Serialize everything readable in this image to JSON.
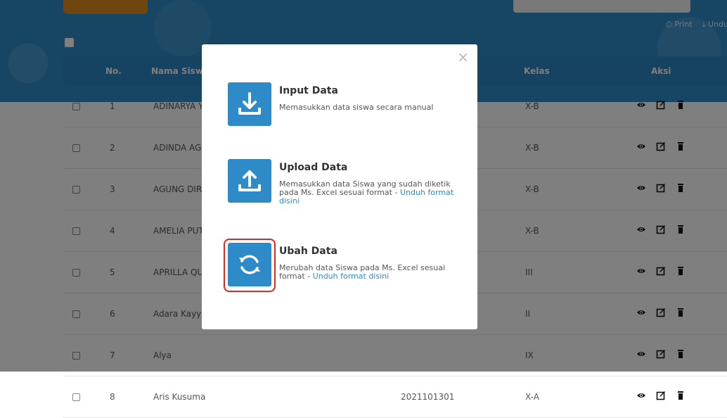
{
  "top": {
    "print_label": "⎙ Print",
    "unduh_label": "⤓ Undu"
  },
  "table": {
    "headers": [
      "No.",
      "Nama Siswa",
      "Kelas",
      "Aksi"
    ],
    "rows": [
      {
        "no": "1",
        "nama": "ADINARYA Y",
        "nis": "",
        "kelas": "X-B"
      },
      {
        "no": "2",
        "nama": "ADINDA AGU",
        "nis": "",
        "kelas": "X-B"
      },
      {
        "no": "3",
        "nama": "AGUNG DIRO",
        "nis": "",
        "kelas": "X-B"
      },
      {
        "no": "4",
        "nama": "AMELIA PUT",
        "nis": "",
        "kelas": "X-B"
      },
      {
        "no": "5",
        "nama": "APRILLA QU",
        "nis": "",
        "kelas": "III"
      },
      {
        "no": "6",
        "nama": "Adara Kayyis",
        "nis": "",
        "kelas": "II"
      },
      {
        "no": "7",
        "nama": "Alya",
        "nis": "",
        "kelas": "IX"
      },
      {
        "no": "8",
        "nama": "Aris Kusuma",
        "nis": "2021101301",
        "kelas": "X-A"
      }
    ]
  },
  "modal": {
    "close_glyph": "×",
    "options": [
      {
        "title": "Input Data",
        "desc": "Memasukkan data siswa secara manual",
        "link": ""
      },
      {
        "title": "Upload Data",
        "desc": "Memasukkan data Siswa yang sudah diketik pada Ms. Excel sesuai format - ",
        "link": "Unduh format disini"
      },
      {
        "title": "Ubah Data",
        "desc": "Merubah data Siswa pada Ms. Excel sesuai format - ",
        "link": "Unduh format disini"
      }
    ]
  },
  "colors": {
    "accent": "#2e8bc8",
    "highlight": "#e1261c"
  },
  "icons": [
    "download-icon",
    "upload-icon",
    "sync-icon",
    "close-icon",
    "eye-icon",
    "edit-icon",
    "trash-icon",
    "print-icon"
  ]
}
